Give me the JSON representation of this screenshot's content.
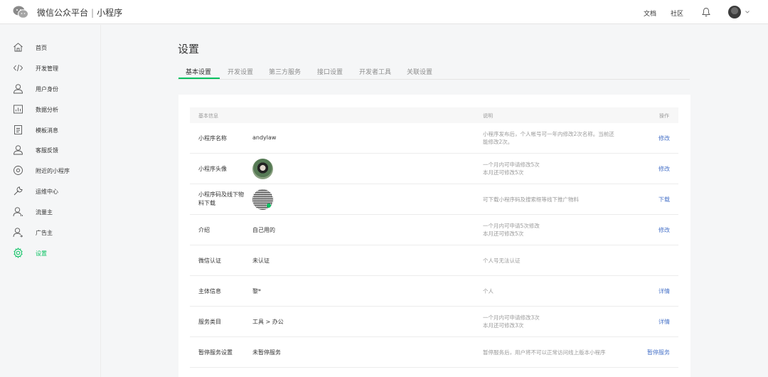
{
  "header": {
    "platform": "微信公众平台",
    "divider": "|",
    "product": "小程序",
    "links": [
      "文档",
      "社区"
    ]
  },
  "sidebar": {
    "items": [
      {
        "label": "首页",
        "icon": "home-icon"
      },
      {
        "label": "开发管理",
        "icon": "code-icon"
      },
      {
        "label": "用户身份",
        "icon": "user-icon"
      },
      {
        "label": "数据分析",
        "icon": "chart-icon"
      },
      {
        "label": "模板消息",
        "icon": "document-icon"
      },
      {
        "label": "客服反馈",
        "icon": "user-icon"
      },
      {
        "label": "附近的小程序",
        "icon": "location-icon"
      },
      {
        "label": "运维中心",
        "icon": "wrench-icon"
      },
      {
        "label": "流量主",
        "icon": "user-icon"
      },
      {
        "label": "广告主",
        "icon": "user-icon"
      },
      {
        "label": "设置",
        "icon": "gear-icon"
      }
    ],
    "active_index": 10
  },
  "main": {
    "title": "设置",
    "tabs": [
      "基本设置",
      "开发设置",
      "第三方服务",
      "接口设置",
      "开发者工具",
      "关联设置"
    ],
    "active_tab": 0
  },
  "table": {
    "headers": {
      "info": "基本信息",
      "desc": "说明",
      "action": "操作"
    },
    "rows": [
      {
        "label": "小程序名称",
        "value": "andylaw",
        "desc": [
          "小程序发布后，个人帐号可一年内修改2次名称。当前还",
          "能修改2次。"
        ],
        "action": "修改"
      },
      {
        "label": "小程序头像",
        "value": "",
        "desc": [
          "一个月内可申请修改5次",
          "本月还可修改5次"
        ],
        "action": "修改"
      },
      {
        "label": "小程序码及线下物料下载",
        "value": "",
        "desc": [
          "可下载小程序码及搜索框等线下推广物料"
        ],
        "action": "下载"
      },
      {
        "label": "介绍",
        "value": "自己用的",
        "desc": [
          "一个月内可申请5次修改",
          "本月还可修改5次"
        ],
        "action": "修改"
      },
      {
        "label": "微信认证",
        "value": "未认证",
        "desc": [
          "个人号无法认证"
        ],
        "action": ""
      },
      {
        "label": "主体信息",
        "value": "黎*",
        "desc": [
          "个人"
        ],
        "action": "详情"
      },
      {
        "label": "服务类目",
        "value": "工具 > 办公",
        "desc": [
          "一个月内可申请修改3次",
          "本月还可修改3次"
        ],
        "action": "详情"
      },
      {
        "label": "暂停服务设置",
        "value": "未暂停服务",
        "desc": [
          "暂停服务后，用户将不可以正常访问线上版本小程序"
        ],
        "action": "暂停服务"
      }
    ]
  },
  "colors": {
    "accent": "#07c160",
    "link": "#4a74c9"
  }
}
